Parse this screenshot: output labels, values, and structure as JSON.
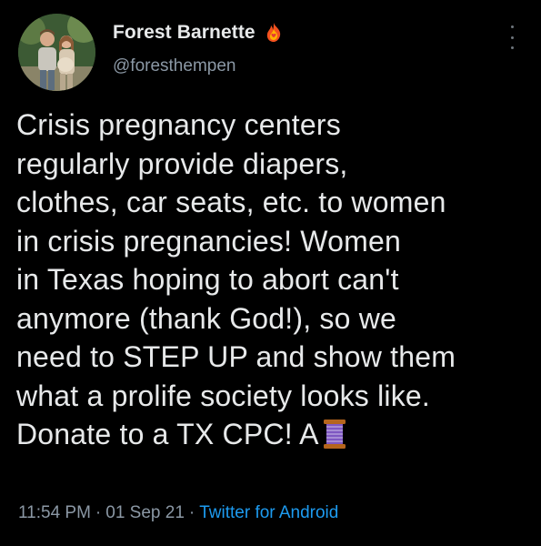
{
  "author": {
    "display_name": "Forest Barnette",
    "handle": "@foresthempen",
    "avatar_icon": "profile-photo",
    "badge_icon": "fire-heart-icon"
  },
  "tweet": {
    "lines": [
      "Crisis pregnancy centers",
      "regularly provide diapers,",
      "clothes, car seats, etc. to women",
      "in crisis pregnancies! Women",
      "in Texas hoping to abort can't",
      "anymore (thank God!), so we",
      "need to STEP UP and show them",
      "what a prolife society looks like.",
      "Donate to a TX CPC! A"
    ],
    "trailing_emoji": "spool-of-thread-icon"
  },
  "meta": {
    "time": "11:54 PM",
    "date": "01 Sep 21",
    "separator": "·",
    "source": "Twitter for Android"
  },
  "colors": {
    "background": "#000000",
    "text": "#e7e9ea",
    "secondary": "#8b98a5",
    "link": "#1d9bf0"
  }
}
